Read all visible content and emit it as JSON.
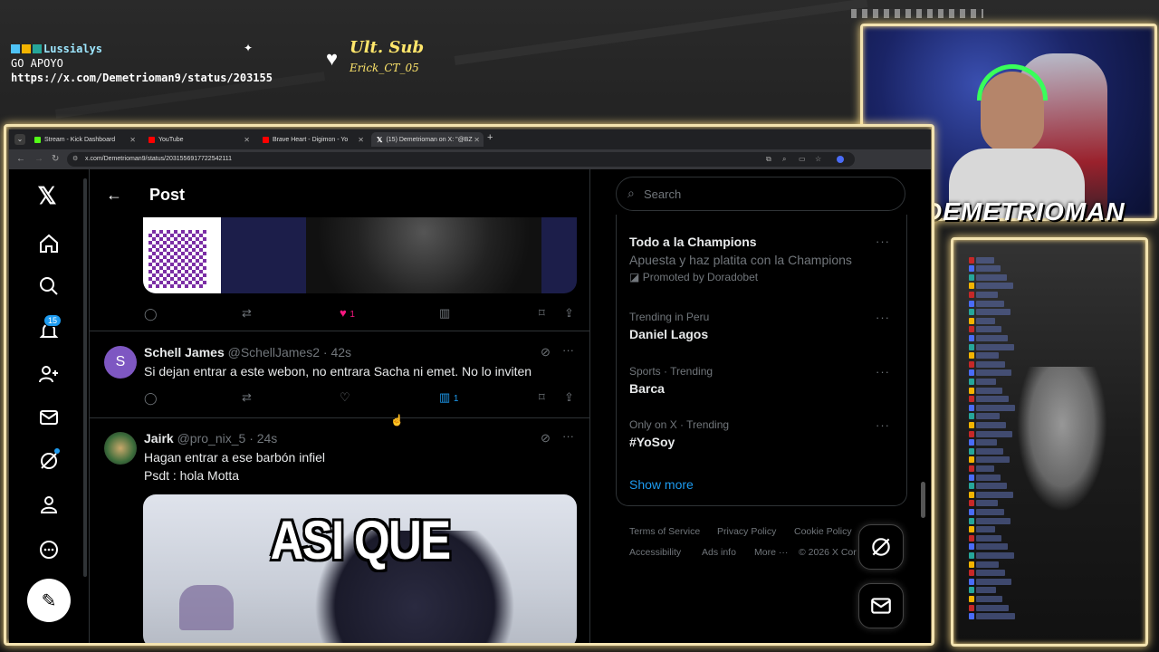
{
  "stream_overlay": {
    "chat_user": "Lussialys",
    "chat_msg1": "GO APOYO",
    "chat_msg2": "https://x.com/Demetrioman9/status/203155",
    "ult_sub_label": "Ult. Sub",
    "ult_sub_name": "Erick_CT_05",
    "streamer_name": "DEMETRIOMAN"
  },
  "browser": {
    "tabs": [
      {
        "label": "Stream - Kick Dashboard",
        "color": "#53fc18"
      },
      {
        "label": "YouTube",
        "color": "#ff0000"
      },
      {
        "label": "Brave Heart - Digimon - Yo",
        "color": "#ff0000"
      },
      {
        "label": "(15) Demetrioman on X: \"@BZ",
        "color": "#ffffff"
      }
    ],
    "new_tab": "+",
    "url": "x.com/Demetrioman9/status/2031556917722542111"
  },
  "sidebar": {
    "notif_count": "15"
  },
  "header": {
    "title": "Post"
  },
  "first_post": {
    "like_count": "1"
  },
  "replies": [
    {
      "initial": "S",
      "name": "Schell James",
      "handle": "@SchellJames2",
      "time": "· 42s",
      "text": "Si dejan entrar a este webon, no entrara Sacha ni emet. No lo inviten",
      "views": "1"
    },
    {
      "name": "Jairk",
      "handle": "@pro_nix_5",
      "time": "· 24s",
      "text": "Hagan entrar a ese barbón infiel",
      "text2": "Psdt : hola Motta",
      "gif_text": "ASI QUE"
    }
  ],
  "right": {
    "search_placeholder": "Search",
    "trends": [
      {
        "name": "Todo a la Champions",
        "desc": "Apuesta y haz platita con la Champions",
        "promo": "Promoted by Doradobet"
      },
      {
        "meta": "Trending in Peru",
        "name": "Daniel Lagos"
      },
      {
        "meta": "Sports · Trending",
        "name": "Barca"
      },
      {
        "meta": "Only on X · Trending",
        "name": "#YoSoy"
      }
    ],
    "show_more": "Show more",
    "footer": {
      "terms": "Terms of Service",
      "privacy": "Privacy Policy",
      "cookie": "Cookie Policy",
      "access": "Accessibility",
      "ads": "Ads info",
      "more": "More ···",
      "copy": "© 2026 X Cor"
    }
  },
  "colors": {
    "accent": "#1d9bf0",
    "like": "#f91880",
    "frame": "#f3e3b0"
  }
}
